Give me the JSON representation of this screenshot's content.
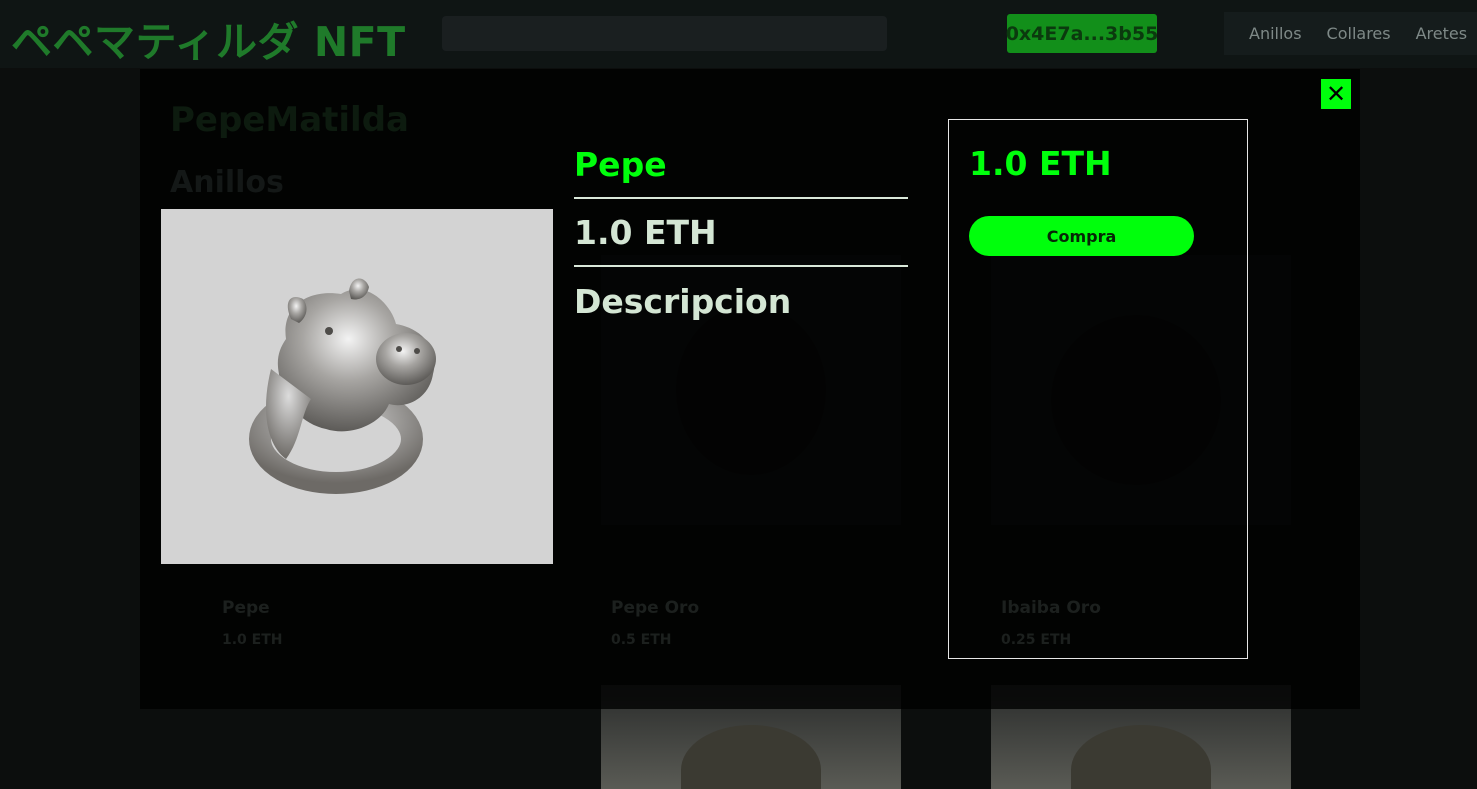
{
  "header": {
    "brand": "ペペマティルダ NFT",
    "search_placeholder": "",
    "wallet": "0x4E7a...3b55",
    "nav": [
      "Anillos",
      "Collares",
      "Aretes"
    ]
  },
  "background": {
    "collection_title": "PepeMatilda",
    "section_title": "Anillos",
    "cards": [
      {
        "name": "Pepe",
        "price": "1.0 ETH"
      },
      {
        "name": "Pepe Oro",
        "price": "0.5 ETH"
      },
      {
        "name": "Ibaiba Oro",
        "price": "0.25 ETH"
      }
    ]
  },
  "modal": {
    "close_label": "✕",
    "name": "Pepe",
    "price": "1.0 ETH",
    "description_label": "Descripcion",
    "buy_panel": {
      "price": "1.0 ETH",
      "buy_label": "Compra"
    }
  },
  "colors": {
    "accent": "#00ff0c",
    "background": "#0c0e0d",
    "modal_overlay": "#000000"
  },
  "icons": {
    "close": "close-icon"
  }
}
